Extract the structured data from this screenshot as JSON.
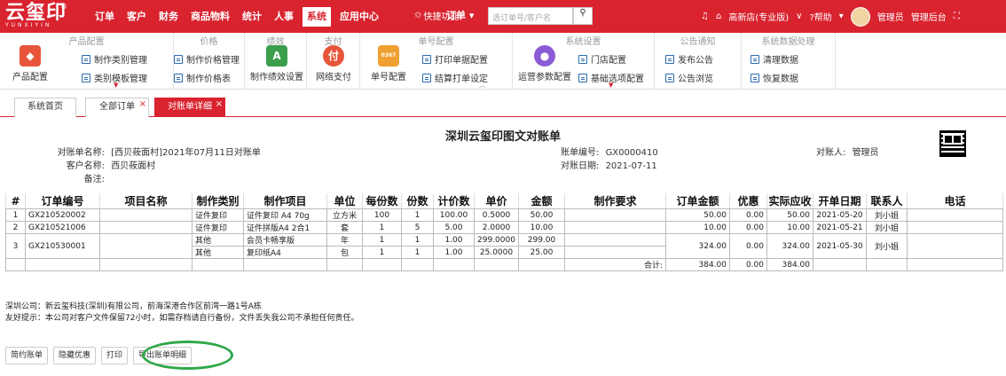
{
  "logo": {
    "main": "云玺印",
    "sub": "YUNXIYIN",
    "reg": "®"
  },
  "nav": [
    "订单",
    "客户",
    "财务",
    "商品物料",
    "统计",
    "人事",
    "系统",
    "应用中心"
  ],
  "nav_active": "系统",
  "quick_label": "快捷功能",
  "order_select": "订单",
  "search_placeholder": "选订单号/客户名",
  "topright": {
    "shop": "高新店(专业版)",
    "help": "帮助",
    "user": "管理员",
    "admin": "管理后台"
  },
  "ribbon": {
    "product": {
      "title": "产品配置",
      "big": "产品配置",
      "items": [
        "制作类别管理",
        "类别模板管理"
      ]
    },
    "price": {
      "title": "价格",
      "items": [
        "制作价格管理",
        "制作价格表"
      ]
    },
    "perf": {
      "title": "绩效",
      "big": "制作绩效设置"
    },
    "pay": {
      "title": "支付",
      "big": "网络支付"
    },
    "orderno": {
      "title": "单号配置",
      "big": "单号配置",
      "big_icon_text": "0367",
      "items": [
        "打印单据配置",
        "结算打单设定"
      ]
    },
    "sys": {
      "title": "系统设置",
      "big": "运营参数配置",
      "items": [
        "门店配置",
        "基础选项配置"
      ]
    },
    "notice": {
      "title": "公告通知",
      "items": [
        "发布公告",
        "公告浏览"
      ]
    },
    "data": {
      "title": "系统数据处理",
      "items": [
        "清理数据",
        "恢复数据"
      ]
    }
  },
  "tabs": [
    "系统首页",
    "全部订单",
    "对账单详细"
  ],
  "statement": {
    "title": "深圳云玺印图文对账单",
    "name_label": "对账单名称:",
    "name": "[西贝莜面村]2021年07月11日对账单",
    "customer_label": "客户名称:",
    "customer": "西贝莜面村",
    "remark_label": "备注:",
    "no_label": "账单编号:",
    "no": "GX0000410",
    "date_label": "对账日期:",
    "date": "2021-07-11",
    "person_label": "对账人:",
    "person": "管理员"
  },
  "table": {
    "headers": [
      "#",
      "订单编号",
      "项目名称",
      "制作类别",
      "制作项目",
      "单位",
      "每份数",
      "份数",
      "计价数",
      "单价",
      "金额",
      "制作要求",
      "订单金额",
      "优惠",
      "实际应收",
      "开单日期",
      "联系人",
      "电话"
    ],
    "rows": [
      {
        "no": "1",
        "order": "GX210520002",
        "cat": "证件复印",
        "item": "证件复印 A4 70g",
        "unit": "立方米",
        "per": "100",
        "copies": "1",
        "qty": "100.00",
        "price": "0.5000",
        "amount": "50.00",
        "total": "50.00",
        "discount": "0.00",
        "receivable": "50.00",
        "date": "2021-05-20",
        "contact": "刘小姐"
      },
      {
        "no": "2",
        "order": "GX210521006",
        "cat": "证件复印",
        "item": "证件拼版A4 2合1",
        "unit": "套",
        "per": "1",
        "copies": "5",
        "qty": "5.00",
        "price": "2.0000",
        "amount": "10.00",
        "total": "10.00",
        "discount": "0.00",
        "receivable": "10.00",
        "date": "2021-05-21",
        "contact": "刘小姐"
      },
      {
        "no": "3",
        "order": "GX210530001",
        "cat": "其他",
        "item": "会员卡畅享版",
        "unit": "年",
        "per": "1",
        "copies": "1",
        "qty": "1.00",
        "price": "299.0000",
        "amount": "299.00",
        "total": "324.00",
        "discount": "0.00",
        "receivable": "324.00",
        "date": "2021-05-30",
        "contact": "刘小姐"
      },
      {
        "cat": "其他",
        "item": "复印纸A4",
        "unit": "包",
        "per": "1",
        "copies": "1",
        "qty": "1.00",
        "price": "25.0000",
        "amount": "25.00"
      }
    ],
    "sum_label": "合计:",
    "sum_total": "384.00",
    "sum_discount": "0.00",
    "sum_receivable": "384.00"
  },
  "footer": {
    "company": "深圳公司：新云玺科技(深圳)有限公司，前海深港合作区前湾一路1号A栋",
    "tip": "友好提示：本公司对客户文件保留72小时，如需存档请自行备份，文件丢失我公司不承担任何责任。"
  },
  "buttons": [
    "简约账单",
    "隐藏优惠",
    "打印",
    "导出账单明细"
  ]
}
